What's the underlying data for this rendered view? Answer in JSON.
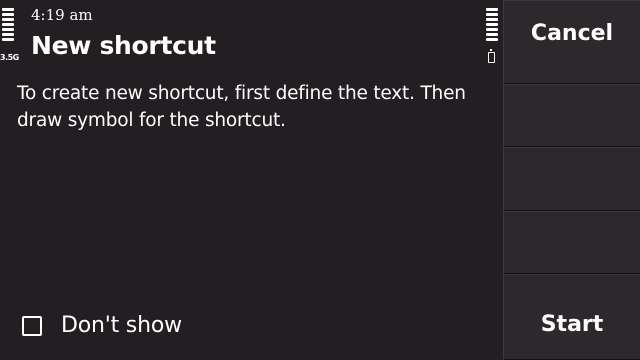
{
  "status": {
    "time": "4:19 am",
    "network": "3.5G",
    "signal_icon": "signal-strength-icon",
    "battery_icon": "battery-icon"
  },
  "dialog": {
    "title": "New shortcut",
    "message": "To create new shortcut, first define the text. Then draw symbol for the shortcut.",
    "checkbox_label": "Don't show",
    "checkbox_checked": false
  },
  "softkeys": {
    "top": "Cancel",
    "slot2": "",
    "slot3": "",
    "slot4": "",
    "bottom": "Start"
  }
}
